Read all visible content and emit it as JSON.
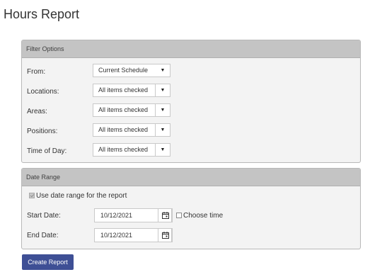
{
  "page": {
    "title": "Hours Report"
  },
  "filter_options": {
    "header": "Filter Options",
    "rows": [
      {
        "label": "From:",
        "value": "Current Schedule"
      },
      {
        "label": "Locations:",
        "value": "All items checked"
      },
      {
        "label": "Areas:",
        "value": "All items checked"
      },
      {
        "label": "Positions:",
        "value": "All items checked"
      },
      {
        "label": "Time of Day:",
        "value": "All items checked"
      }
    ]
  },
  "date_range": {
    "header": "Date Range",
    "use_date_range_label": "Use date range for the report",
    "use_date_range_checked": true,
    "start_date_label": "Start Date:",
    "start_date_value": "10/12/2021",
    "end_date_label": "End Date:",
    "end_date_value": "10/12/2021",
    "choose_time_label": "Choose time",
    "choose_time_checked": false
  },
  "actions": {
    "create_report_label": "Create Report"
  },
  "colors": {
    "primary_button": "#3e4f95",
    "panel_header": "#c4c4c4",
    "panel_body": "#f3f3f3"
  }
}
